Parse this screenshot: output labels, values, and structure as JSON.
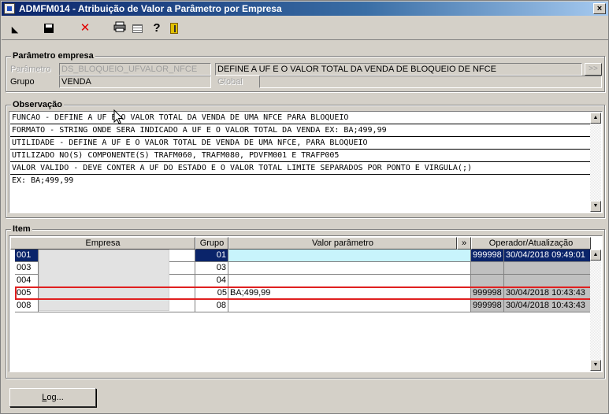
{
  "window": {
    "title": "ADMFM014 - Atribuição de Valor a Parâmetro por Empresa",
    "close_label": "×"
  },
  "toolbar": {
    "buttons": [
      {
        "name": "cursor-icon"
      },
      {
        "name": "save-icon"
      },
      {
        "name": "cancel-icon",
        "glyph": "✕",
        "color": "#e00000"
      },
      {
        "name": "print-icon",
        "glyph": "🖶"
      },
      {
        "name": "grid-icon"
      },
      {
        "name": "help-icon",
        "glyph": "?"
      },
      {
        "name": "exit-icon"
      }
    ]
  },
  "parametro_empresa": {
    "legend": "Parâmetro empresa",
    "parametro_label": "Parâmetro",
    "parametro_value": "DS_BLOQUEIO_UFVALOR_NFCE",
    "descricao_value": "DEFINE A UF E O VALOR TOTAL DA VENDA DE BLOQUEIO DE NFCE",
    "lookup_label": ">>",
    "grupo_label": "Grupo",
    "grupo_value": "VENDA",
    "global_label": "Global",
    "global_value": ""
  },
  "observacao": {
    "legend": "Observação",
    "lines": [
      "FUNCAO - DEFINE A UF E O VALOR TOTAL DA VENDA DE UMA NFCE PARA BLOQUEIO",
      "FORMATO - STRING ONDE SERA INDICADO A UF E O VALOR TOTAL DA VENDA EX: BA;499,99",
      "UTILIDADE - DEFINE A UF E O VALOR TOTAL DE VENDA DE UMA NFCE, PARA BLOQUEIO",
      "UTILIZADO NO(S) COMPONENTE(S) TRAFM060, TRAFM080, PDVFM001 E TRAFP005",
      "VALOR VALIDO - DEVE CONTER A UF DO ESTADO E O VALOR TOTAL LIMITE SEPARADOS POR PONTO E VIRGULA(;)",
      "EX: BA;499,99"
    ],
    "scroll_up": "▲",
    "scroll_down": "▼"
  },
  "item": {
    "legend": "Item",
    "columns": {
      "empresa": "Empresa",
      "grupo": "Grupo",
      "valor": "Valor parâmetro",
      "expand": "»",
      "operador": "Operador/Atualização"
    },
    "rows": [
      {
        "empresa_code": "001",
        "grupo": "01",
        "valor": "",
        "operador": "999998",
        "atualizacao": "30/04/2018 09:49:01"
      },
      {
        "empresa_code": "003",
        "grupo": "03",
        "valor": "",
        "operador": "",
        "atualizacao": ""
      },
      {
        "empresa_code": "004",
        "grupo": "04",
        "valor": "",
        "operador": "",
        "atualizacao": ""
      },
      {
        "empresa_code": "005",
        "grupo": "05",
        "valor": "BA;499,99",
        "operador": "999998",
        "atualizacao": "30/04/2018 10:43:43"
      },
      {
        "empresa_code": "008",
        "grupo": "08",
        "valor": "",
        "operador": "999998",
        "atualizacao": "30/04/2018 10:43:43"
      }
    ],
    "scroll_up": "▲",
    "scroll_down": "▼"
  },
  "footer": {
    "log_button_prefix": "L",
    "log_button_rest": "og..."
  }
}
